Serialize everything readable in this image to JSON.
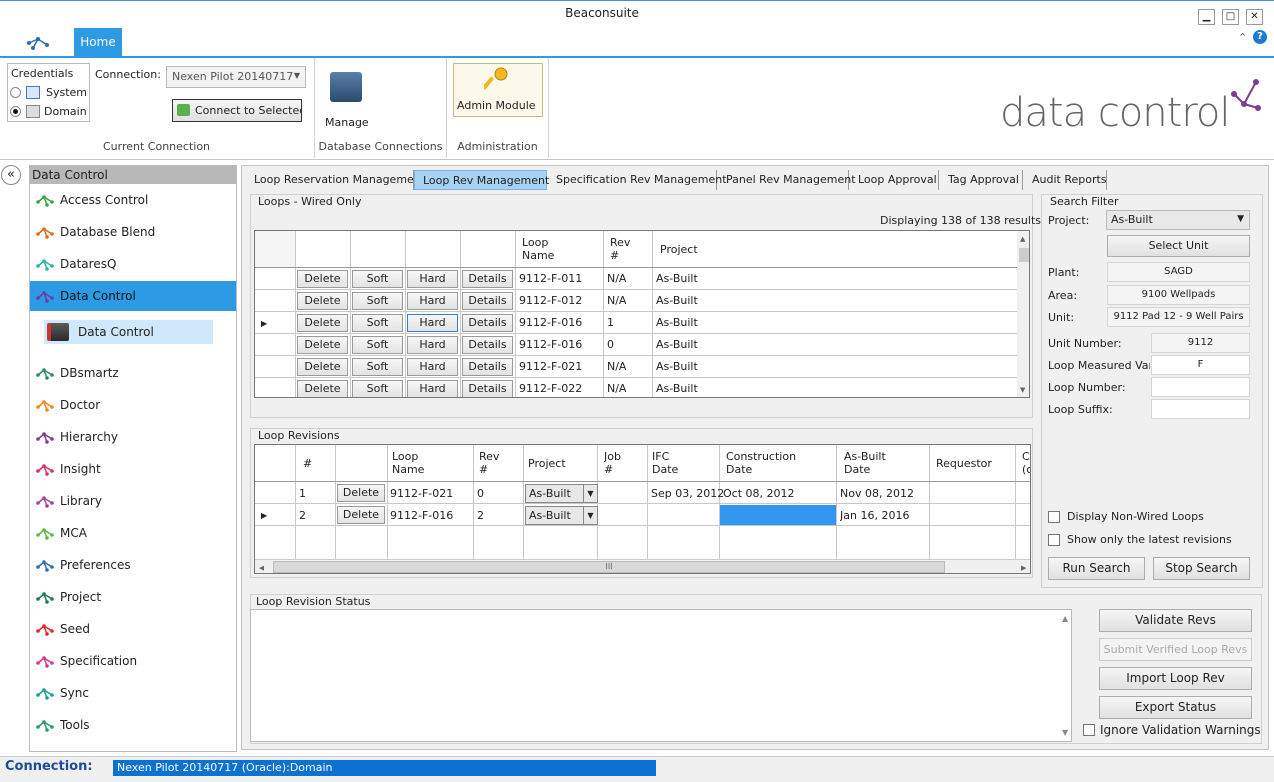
{
  "window": {
    "title": "Beaconsuite",
    "minimize": "▁",
    "maximize": "□",
    "close": "✕"
  },
  "ribbon": {
    "home_tab": "Home",
    "credentials": {
      "label": "Credentials",
      "system": "System",
      "domain": "Domain"
    },
    "connection_label": "Connection:",
    "connection_value": "Nexen Pilot 20140717",
    "connect_button": "Connect to Selected",
    "current_connection_group": "Current Connection",
    "manage_label": "Manage",
    "database_connections_group": "Database Connections",
    "admin_module": "Admin Module",
    "administration_group": "Administration",
    "brand": "data control"
  },
  "nav": {
    "header": "Data Control",
    "items": [
      {
        "label": "Access Control",
        "color": "#3aa34a"
      },
      {
        "label": "Database Blend",
        "color": "#e36b1d"
      },
      {
        "label": "DataresQ",
        "color": "#2bb3a3"
      },
      {
        "label": "Data Control",
        "color": "#6a3f9e"
      },
      {
        "label": "DBsmartz",
        "color": "#2a8a6a"
      },
      {
        "label": "Doctor",
        "color": "#f08a1c"
      },
      {
        "label": "Hierarchy",
        "color": "#7a3d97"
      },
      {
        "label": "Insight",
        "color": "#d6336c"
      },
      {
        "label": "Library",
        "color": "#a2449b"
      },
      {
        "label": "MCA",
        "color": "#5fb847"
      },
      {
        "label": "Preferences",
        "color": "#2e6fb0"
      },
      {
        "label": "Project",
        "color": "#1d7a5a"
      },
      {
        "label": "Seed",
        "color": "#e0262e"
      },
      {
        "label": "Specification",
        "color": "#d23a8a"
      },
      {
        "label": "Sync",
        "color": "#1e9f8f"
      },
      {
        "label": "Tools",
        "color": "#2a9a6a"
      }
    ],
    "subitem": "Data Control"
  },
  "tabs": [
    "Loop Reservation Management",
    "Loop Rev Management",
    "Specification Rev Management",
    "Panel Rev Management",
    "Loop Approval",
    "Tag Approval",
    "Audit Reports"
  ],
  "loops": {
    "title": "Loops - Wired Only",
    "count": "Displaying 138 of 138 results",
    "headers": {
      "loop_name": "Loop\nName",
      "rev": "Rev\n#",
      "project": "Project"
    },
    "button_labels": {
      "delete": "Delete",
      "soft": "Soft",
      "hard": "Hard",
      "details": "Details"
    },
    "rows": [
      {
        "loop": "9112-F-011",
        "rev": "N/A",
        "project": "As-Built"
      },
      {
        "loop": "9112-F-012",
        "rev": "N/A",
        "project": "As-Built"
      },
      {
        "loop": "9112-F-016",
        "rev": "1",
        "project": "As-Built"
      },
      {
        "loop": "9112-F-016",
        "rev": "0",
        "project": "As-Built"
      },
      {
        "loop": "9112-F-021",
        "rev": "N/A",
        "project": "As-Built"
      },
      {
        "loop": "9112-F-022",
        "rev": "N/A",
        "project": "As-Built"
      }
    ]
  },
  "revisions": {
    "title": "Loop Revisions",
    "headers": [
      "#",
      "",
      "Loop\nName",
      "Rev\n#",
      "Project",
      "Job\n#",
      "IFC\nDate",
      "Construction\nDate",
      "As-Built\nDate",
      "Requestor",
      "C\n(c"
    ],
    "rows": [
      {
        "n": "1",
        "del": "Delete",
        "loop": "9112-F-021",
        "rev": "0",
        "project": "As-Built",
        "job": "",
        "ifc": "Sep 03, 2012",
        "construction": "Oct 08, 2012",
        "asbuilt": "Nov 08, 2012",
        "requestor": ""
      },
      {
        "n": "2",
        "del": "Delete",
        "loop": "9112-F-016",
        "rev": "2",
        "project": "As-Built",
        "job": "",
        "ifc": "",
        "construction": "",
        "asbuilt": "Jan 16, 2016",
        "requestor": ""
      }
    ],
    "scroll_grip": "III"
  },
  "search": {
    "title": "Search Filter",
    "project_label": "Project:",
    "project_value": "As-Built",
    "select_unit": "Select Unit",
    "plant_label": "Plant:",
    "plant": "SAGD",
    "area_label": "Area:",
    "area": "9100 Wellpads",
    "unit_label": "Unit:",
    "unit": "9112 Pad 12 - 9 Well Pairs",
    "unit_number_label": "Unit Number:",
    "unit_number": "9112",
    "measured_label": "Loop Measured Var",
    "measured": "F",
    "loop_number_label": "Loop Number:",
    "loop_number": "",
    "loop_suffix_label": "Loop Suffix:",
    "loop_suffix": "",
    "non_wired": "Display Non-Wired Loops",
    "latest": "Show only the latest revisions",
    "run": "Run Search",
    "stop": "Stop Search"
  },
  "status_panel": {
    "title": "Loop Revision Status",
    "validate": "Validate Revs",
    "submit": "Submit Verified Loop Revs",
    "import": "Import Loop Rev",
    "export": "Export Status",
    "ignore": "Ignore Validation Warnings"
  },
  "statusbar": {
    "label": "Connection:",
    "value": "Nexen Pilot 20140717 (Oracle):Domain"
  }
}
